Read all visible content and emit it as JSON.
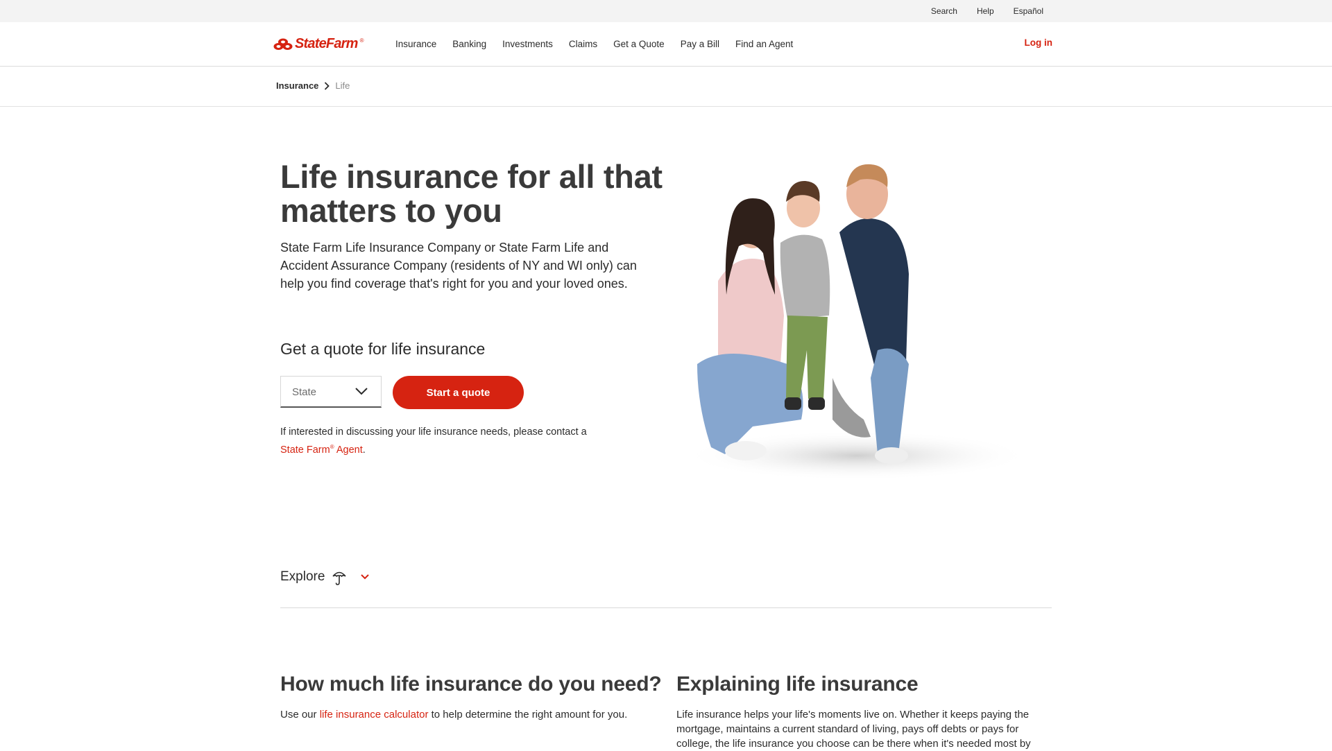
{
  "utility": {
    "search": "Search",
    "help": "Help",
    "espanol": "Español"
  },
  "nav": {
    "logo_text": "StateFarm",
    "logo_reg": "®",
    "items": [
      {
        "label": "Insurance"
      },
      {
        "label": "Banking"
      },
      {
        "label": "Investments"
      },
      {
        "label": "Claims"
      },
      {
        "label": "Get a Quote"
      },
      {
        "label": "Pay a Bill"
      },
      {
        "label": "Find an Agent"
      }
    ],
    "login": "Log in"
  },
  "breadcrumb": {
    "parent": "Insurance",
    "current": "Life"
  },
  "hero": {
    "title": "Life insurance for all that matters to you",
    "description": "State Farm Life Insurance Company or State Farm Life and Accident Assurance Company (residents of NY and WI only) can help you find coverage that's right for you and your loved ones.",
    "quote_heading": "Get a quote for life insurance",
    "state_placeholder": "State",
    "start_button": "Start a quote",
    "contact_prefix": "If interested in discussing your life insurance needs, please contact a",
    "agent_link_before": "State Farm",
    "agent_link_reg": "®",
    "agent_link_after": " Agent",
    "contact_suffix": "."
  },
  "explore": {
    "label": "Explore"
  },
  "sections": {
    "need": {
      "title": "How much life insurance do you need?",
      "text_before": "Use our ",
      "link": "life insurance calculator",
      "text_after": " to help determine the right amount for you."
    },
    "explaining": {
      "title": "Explaining life insurance",
      "text": "Life insurance helps your life's moments live on. Whether it keeps paying the mortgage, maintains a current standard of living, pays off debts or pays for college, the life insurance you choose can be there when it's needed most by"
    }
  },
  "colors": {
    "brand_red": "#d62311",
    "text": "#2b2b2b",
    "utility_bg": "#f3f3f3"
  },
  "icons": {
    "breadcrumb_separator": "chevron-right-icon",
    "state_dropdown": "chevron-down-icon",
    "explore": "umbrella-icon",
    "explore_toggle": "chevron-down-icon"
  }
}
